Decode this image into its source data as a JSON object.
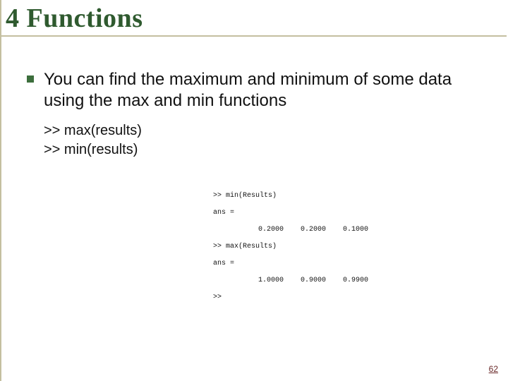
{
  "title": "4 Functions",
  "bullet": "You can find the maximum and minimum of some data using the max and min functions",
  "code": {
    "line1": ">> max(results)",
    "line2": ">> min(results)"
  },
  "console": {
    "cmd1": ">> min(Results)",
    "ans_label1": "ans =",
    "vals1": "    0.2000    0.2000    0.1000",
    "cmd2": ">> max(Results)",
    "ans_label2": "ans =",
    "vals2": "    1.0000    0.9000    0.9900",
    "prompt": ">>"
  },
  "page": "62"
}
